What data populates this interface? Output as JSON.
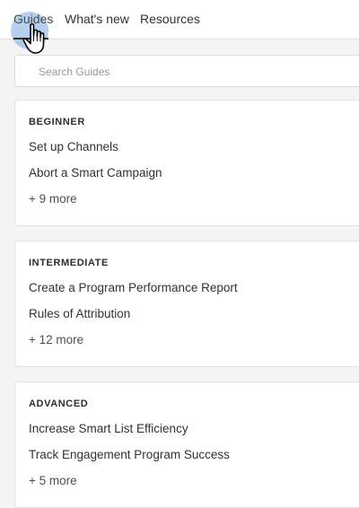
{
  "nav": {
    "tabs": [
      {
        "label": "Guides",
        "active": true
      },
      {
        "label": "What's new"
      },
      {
        "label": "Resources"
      }
    ]
  },
  "search": {
    "placeholder": "Search Guides",
    "value": ""
  },
  "sections": [
    {
      "title": "BEGINNER",
      "links": [
        "Set up Channels",
        "Abort a Smart Campaign"
      ],
      "more": "+ 9 more"
    },
    {
      "title": "INTERMEDIATE",
      "links": [
        "Create a Program Performance Report",
        "Rules of Attribution"
      ],
      "more": "+ 12 more"
    },
    {
      "title": "ADVANCED",
      "links": [
        "Increase Smart List Efficiency",
        "Track Engagement Program Success"
      ],
      "more": "+ 5 more"
    }
  ],
  "colors": {
    "background": "#f4f4f4",
    "card": "#ffffff",
    "cursor_halo": "#78aae1"
  }
}
